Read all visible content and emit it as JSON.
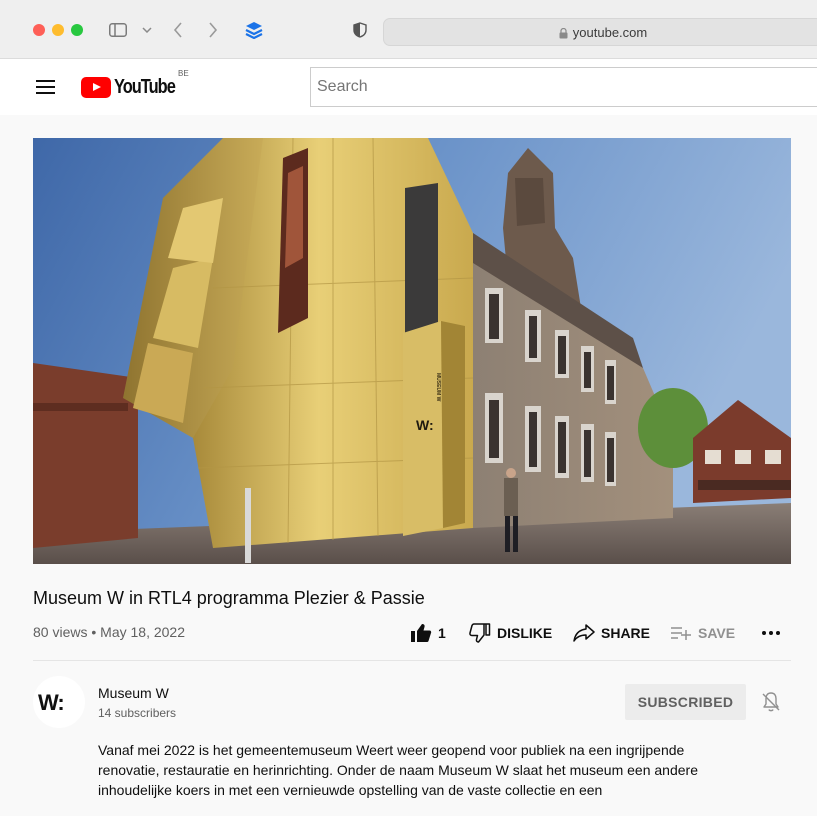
{
  "browser": {
    "url": "youtube.com"
  },
  "header": {
    "logo_text": "YouTube",
    "region": "BE",
    "search_placeholder": "Search"
  },
  "video": {
    "title": "Museum W in RTL4 programma Plezier & Passie",
    "views": "80 views",
    "separator": "•",
    "date": "May 18, 2022",
    "building_sign": "W:",
    "facade_sign": "MUSEUM W"
  },
  "actions": {
    "like_count": "1",
    "dislike_label": "DISLIKE",
    "share_label": "SHARE",
    "save_label": "SAVE"
  },
  "channel": {
    "name": "Museum W",
    "subscribers": "14 subscribers",
    "subscribe_button": "SUBSCRIBED",
    "avatar_text": "W:"
  },
  "description": "Vanaf mei 2022 is het gemeentemuseum Weert weer geopend voor publiek na een ingrijpende renovatie, restauratie en herinrichting. Onder de naam Museum W slaat het museum een andere inhoudelijke koers in met een vernieuwde opstelling van de vaste collectie en een",
  "colors": {
    "youtube_red": "#ff0000",
    "text_primary": "#0f0f0f",
    "text_secondary": "#606060",
    "page_background": "#f9f9f9"
  },
  "icons": [
    "sidebar-toggle-icon",
    "chevron-down-icon",
    "back-icon",
    "forward-icon",
    "buffer-extension-icon",
    "privacy-shield-icon",
    "lock-icon",
    "menu-icon",
    "youtube-play-icon",
    "thumbs-up-icon",
    "thumbs-down-icon",
    "share-icon",
    "save-playlist-icon",
    "more-icon",
    "bell-off-icon"
  ]
}
